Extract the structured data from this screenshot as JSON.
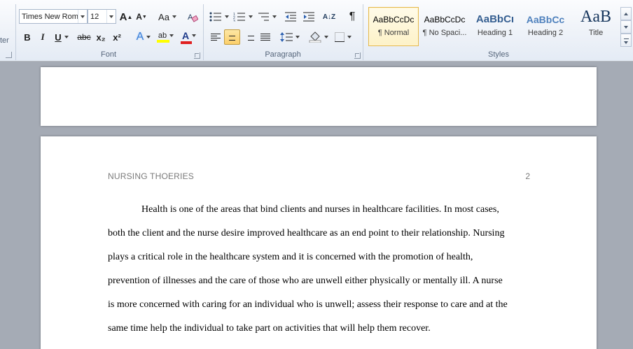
{
  "ribbon": {
    "clipboard_fragment": "ter",
    "font": {
      "label": "Font",
      "font_name": "Times New Rom",
      "font_size": "12",
      "grow_label": "A",
      "shrink_label": "A",
      "change_case_label": "Aa",
      "bold_label": "B",
      "italic_label": "I",
      "underline_label": "U",
      "strike_label": "abc",
      "subscript_label": "x₂",
      "superscript_label": "x²",
      "effects_label": "A",
      "highlight_label": "ab",
      "font_color_label": "A",
      "highlight_color": "#ffff00",
      "font_color": "#e02020"
    },
    "paragraph": {
      "label": "Paragraph",
      "show_marks_label": "¶",
      "sort_label": "A↓Z",
      "selected_alignment": "center"
    },
    "styles": {
      "label": "Styles",
      "items": [
        {
          "sample": "AaBbCcDc",
          "name": "¶ Normal"
        },
        {
          "sample": "AaBbCcDc",
          "name": "¶ No Spaci..."
        },
        {
          "sample": "AaBbCı",
          "name": "Heading 1"
        },
        {
          "sample": "AaBbCc",
          "name": "Heading 2"
        },
        {
          "sample": "AaB",
          "name": "Title"
        }
      ]
    }
  },
  "document": {
    "header": "NURSING THOERIES",
    "page_number": "2",
    "lines": [
      "Health is one of the areas that bind clients and nurses in healthcare facilities. In most cases,",
      "both the client and the nurse desire improved healthcare as an end point to their relationship. Nursing",
      "plays a critical role in the healthcare system and it is concerned with the promotion of health,",
      "prevention of illnesses and the care of those who are unwell either physically or mentally ill. A nurse",
      "is more concerned with caring for an individual who is unwell; assess their response to care and at the",
      "same time help the individual to take part on activities that will help them recover."
    ]
  }
}
